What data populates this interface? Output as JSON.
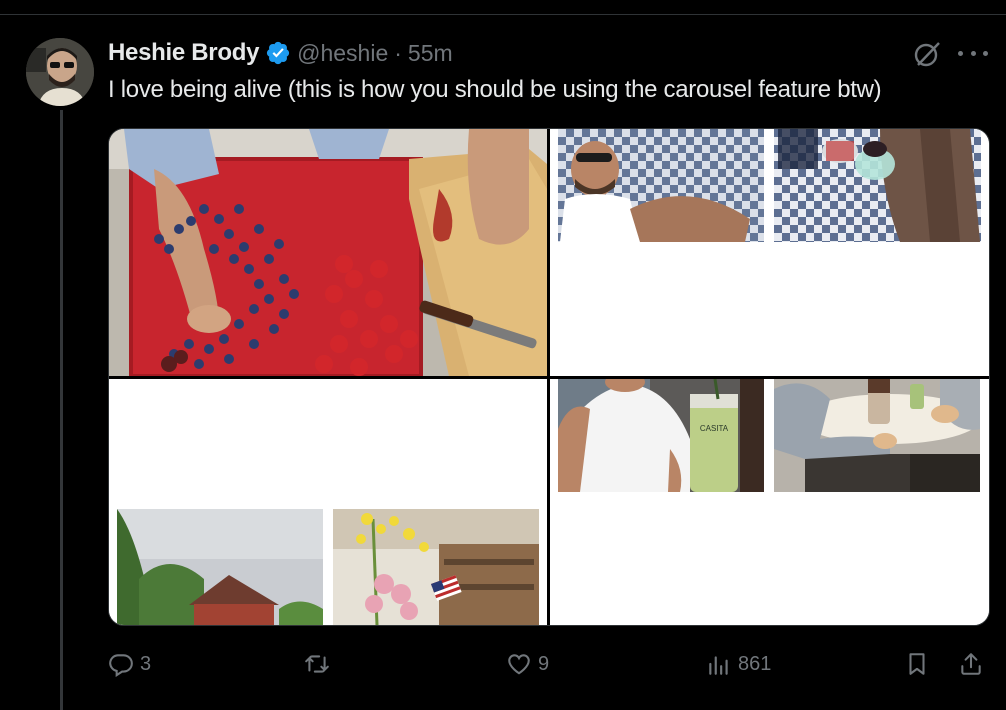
{
  "tweet": {
    "author_name": "Heshie Brody",
    "handle": "@heshie",
    "separator": "·",
    "time": "55m",
    "text": "I love being alive (this is how you should be using the carousel feature btw)",
    "verified": true
  },
  "media": {
    "casita_label": "CASITA"
  },
  "actions": {
    "replies": "3",
    "likes": "9",
    "views": "861"
  },
  "colors": {
    "background": "#000000",
    "text_primary": "#e7e9ea",
    "text_secondary": "#71767b",
    "verified_blue": "#1d9bf0",
    "divider": "#2f3336"
  },
  "icons": [
    "verified-badge-icon",
    "grok-icon",
    "more-icon",
    "reply-icon",
    "retweet-icon",
    "like-icon",
    "views-icon",
    "bookmark-icon",
    "share-icon"
  ]
}
